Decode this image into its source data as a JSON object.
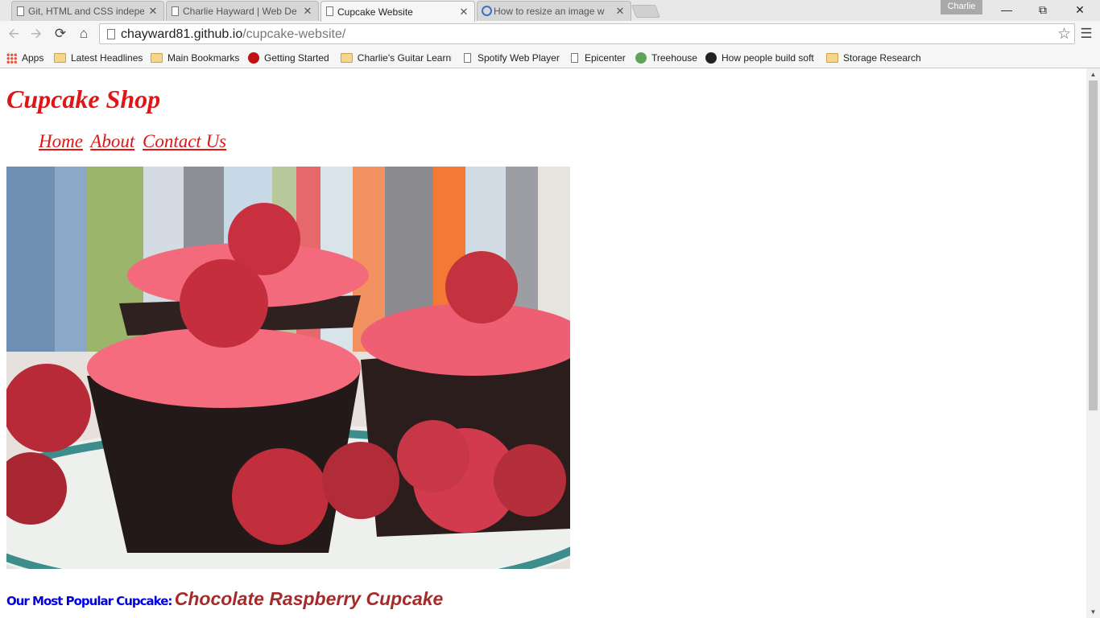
{
  "browser": {
    "tabs": [
      {
        "title": "Git, HTML and CSS indepe",
        "active": false,
        "icon": "page-icon"
      },
      {
        "title": "Charlie Hayward | Web De",
        "active": false,
        "icon": "page-icon"
      },
      {
        "title": "Cupcake Website",
        "active": true,
        "icon": "page-icon"
      },
      {
        "title": "How to resize an image w",
        "active": false,
        "icon": "globe-icon"
      }
    ],
    "profile_name": "Charlie",
    "url_host": "chayward81.github.io",
    "url_path": "/cupcake-website/",
    "bookmarks": [
      {
        "label": "Apps",
        "icon": "apps-grid-icon"
      },
      {
        "label": "Latest Headlines",
        "icon": "folder-icon"
      },
      {
        "label": "Main Bookmarks",
        "icon": "folder-icon"
      },
      {
        "label": "Getting Started",
        "icon": "firefox-icon"
      },
      {
        "label": "Charlie's Guitar Learni",
        "icon": "folder-icon"
      },
      {
        "label": "Spotify Web Player",
        "icon": "page-icon"
      },
      {
        "label": "Epicenter",
        "icon": "page-icon"
      },
      {
        "label": "Treehouse",
        "icon": "treehouse-icon"
      },
      {
        "label": "How people build soft",
        "icon": "github-icon"
      },
      {
        "label": "Storage Research",
        "icon": "folder-icon"
      }
    ]
  },
  "page": {
    "title": "Cupcake Shop",
    "nav": [
      "Home",
      "About",
      "Contact Us"
    ],
    "popular_label": "Our Most Popular Cupcake:",
    "popular_value": "Chocolate Raspberry Cupcake",
    "colors": {
      "title": "#e01515",
      "label": "#0000e0",
      "value": "#a52a2a"
    }
  }
}
